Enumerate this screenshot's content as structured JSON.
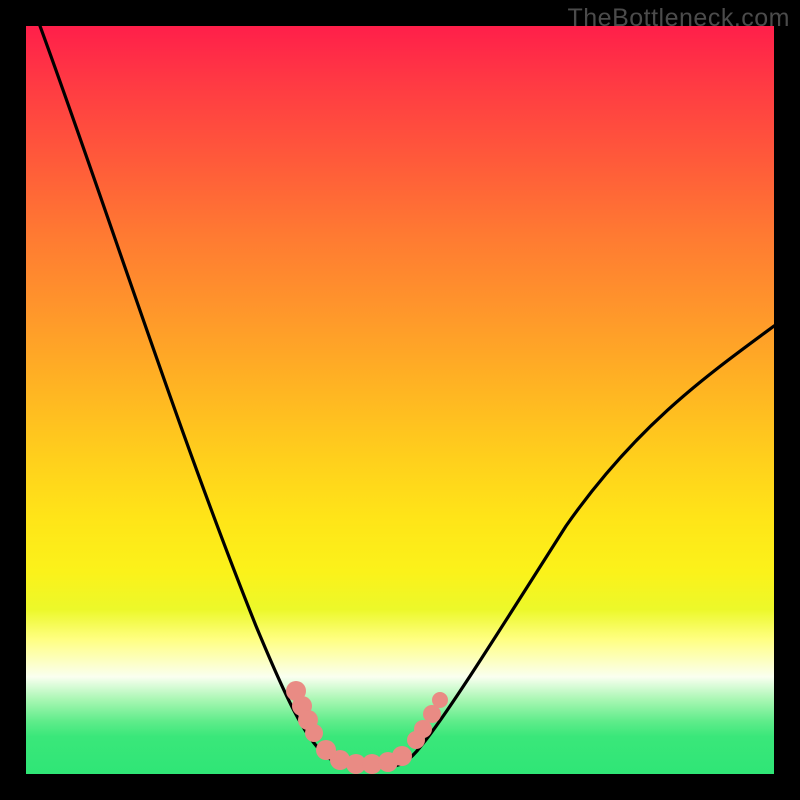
{
  "watermark": "TheBottleneck.com",
  "chart_data": {
    "type": "line",
    "title": "",
    "xlabel": "",
    "ylabel": "",
    "xlim": [
      0,
      100
    ],
    "ylim": [
      0,
      100
    ],
    "series": [
      {
        "name": "bottleneck-curve",
        "x": [
          0,
          5,
          10,
          15,
          20,
          25,
          30,
          35,
          37.5,
          40,
          42.5,
          45,
          47.5,
          50,
          52.5,
          55,
          60,
          65,
          70,
          75,
          80,
          85,
          90,
          95,
          100
        ],
        "values": [
          100,
          88,
          76,
          64,
          52,
          40,
          28,
          16,
          10,
          5,
          1.5,
          1,
          1.5,
          3,
          7,
          13,
          21,
          28,
          34,
          40,
          45,
          50,
          54,
          58,
          60
        ]
      }
    ],
    "annotations": [
      {
        "name": "marker-cluster-left",
        "shape": "blob",
        "color": "#e98b84",
        "x_range": [
          35.5,
          38.5
        ],
        "y_range": [
          6,
          13
        ]
      },
      {
        "name": "marker-cluster-bottom",
        "shape": "blob",
        "color": "#e98b84",
        "x_range": [
          40,
          50
        ],
        "y_range": [
          1,
          4
        ]
      },
      {
        "name": "marker-cluster-right",
        "shape": "blob",
        "color": "#e98b84",
        "x_range": [
          51.5,
          54.5
        ],
        "y_range": [
          7,
          13
        ]
      }
    ],
    "background": "red-yellow-green vertical gradient"
  }
}
